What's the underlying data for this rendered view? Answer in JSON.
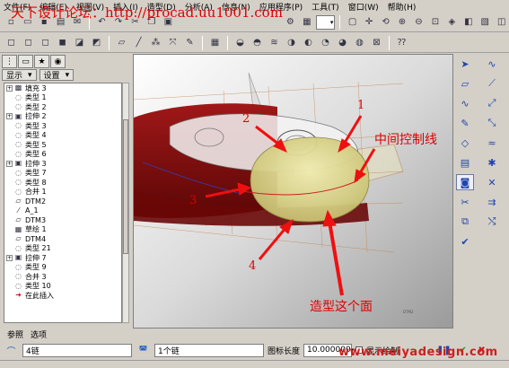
{
  "menu": [
    "文件(F)",
    "编辑(E)",
    "视图(V)",
    "插入(I)",
    "造型(D)",
    "分析(A)",
    "信息(N)",
    "应用程序(P)",
    "工具(T)",
    "窗口(W)",
    "帮助(H)"
  ],
  "watermark_top": "天下设计论坛：http://procad.uu1001.com",
  "left_panel": {
    "display_button": "显示",
    "settings_button": "设置",
    "tree": [
      {
        "exp": "+",
        "icon": "fill-icon",
        "label": "填充 3"
      },
      {
        "exp": "",
        "icon": "quilt-icon",
        "label": "类型 1"
      },
      {
        "exp": "",
        "icon": "quilt-icon",
        "label": "类型 2"
      },
      {
        "exp": "+",
        "icon": "extrude-icon",
        "label": "拉伸 2"
      },
      {
        "exp": "",
        "icon": "quilt-icon",
        "label": "类型 3"
      },
      {
        "exp": "",
        "icon": "quilt-icon",
        "label": "类型 4"
      },
      {
        "exp": "",
        "icon": "quilt-icon",
        "label": "类型 5"
      },
      {
        "exp": "",
        "icon": "quilt-icon",
        "label": "类型 6"
      },
      {
        "exp": "+",
        "icon": "extrude-icon",
        "label": "拉伸 3"
      },
      {
        "exp": "",
        "icon": "quilt-icon",
        "label": "类型 7"
      },
      {
        "exp": "",
        "icon": "quilt-icon",
        "label": "类型 8"
      },
      {
        "exp": "",
        "icon": "merge-icon",
        "label": "合并 1"
      },
      {
        "exp": "",
        "icon": "datum-plane-icon",
        "label": "DTM2"
      },
      {
        "exp": "",
        "icon": "axis-icon",
        "label": "A_1"
      },
      {
        "exp": "",
        "icon": "datum-plane-icon",
        "label": "DTM3"
      },
      {
        "exp": "",
        "icon": "sketch-icon",
        "label": "草绘 1"
      },
      {
        "exp": "",
        "icon": "datum-plane-icon",
        "label": "DTM4"
      },
      {
        "exp": "",
        "icon": "quilt-icon",
        "label": "类型 21"
      },
      {
        "exp": "+",
        "icon": "extrude-icon",
        "label": "拉伸 7"
      },
      {
        "exp": "",
        "icon": "quilt-icon",
        "label": "类型 9"
      },
      {
        "exp": "",
        "icon": "merge-icon",
        "label": "合并 3"
      },
      {
        "exp": "",
        "icon": "quilt-icon",
        "label": "类型 10"
      },
      {
        "exp": "",
        "icon": "insert-here-icon",
        "label": "在此插入"
      }
    ]
  },
  "viewport": {
    "callouts": [
      "1",
      "2",
      "3",
      "4"
    ],
    "annotation_mid_curve": "中间控制线",
    "annotation_surface": "造型这个面",
    "small_label": "DTM2"
  },
  "bottom_tabs": [
    "参照",
    "选项"
  ],
  "dashboard": {
    "chain_field": "4链",
    "chain_count": "1个链",
    "length_label": "图标长度",
    "length_value": "10.000000",
    "show_label": "显示绘制"
  },
  "site_watermark": "www.meiyadesign.com",
  "colors": {
    "red_surface": "#8b1010",
    "yellow_surface": "#e6e090",
    "annotation_red": "#dd0000",
    "arrow_red": "#ee1010"
  }
}
